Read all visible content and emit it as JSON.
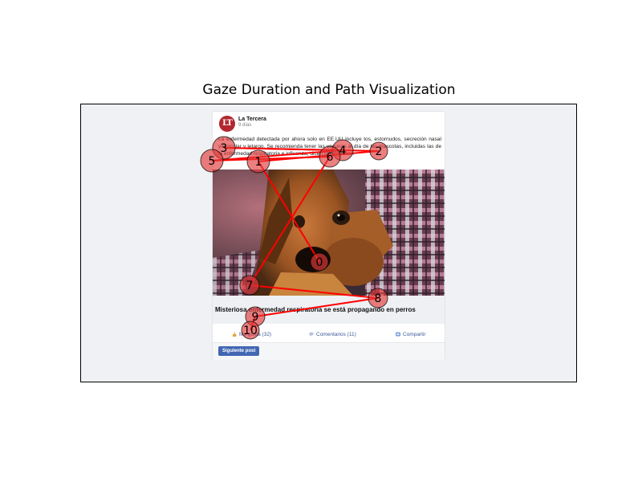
{
  "figure": {
    "title": "Gaze Duration and Path Visualization"
  },
  "post": {
    "avatar_text": "LT",
    "page_name": "La Tercera",
    "time": "9 días",
    "text": "La enfermedad detectada por ahora solo en EE.UU incluye tos, estornudos, secreción nasal y/o ocular y letargo. Se recomienda tener las vacunas al día de las mascotas, incluidas las de la enfermedad respiratoria e influenza, dicen los expertos.",
    "image": "dog-photo",
    "link_title": "Misteriosa enfermedad respiratoria se está propagando en perros",
    "actions": {
      "like": "Me gusta (32)",
      "comment": "Comentarios (11)",
      "share": "Compartir"
    },
    "next_button": "Siguiente post"
  },
  "gaze": {
    "path_color": "#ff0000",
    "fixation_color": "#e23a3a",
    "fixation_labels": [
      "0",
      "1",
      "2",
      "3",
      "4",
      "5",
      "6",
      "7",
      "8",
      "9",
      "10"
    ]
  }
}
